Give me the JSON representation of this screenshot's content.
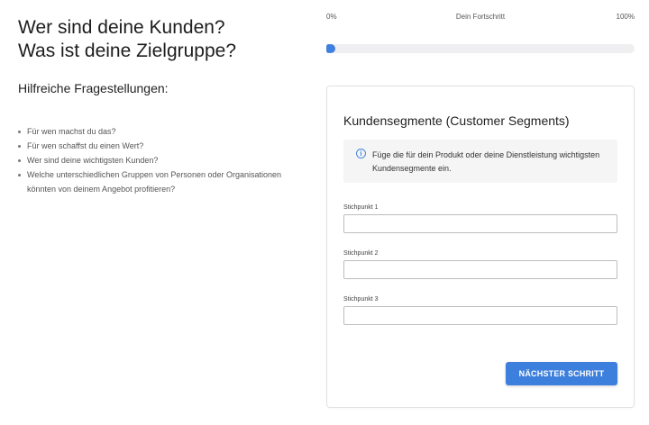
{
  "intro": {
    "title_line1": "Wer sind deine Kunden?",
    "title_line2": "Was ist deine Zielgruppe?",
    "subheading": "Hilfreiche Fragestellungen:",
    "questions": [
      "Für wen machst du das?",
      "Für wen schaffst du einen Wert?",
      "Wer sind deine wichtigsten Kunden?",
      "Welche unterschiedlichen Gruppen von Personen oder Organisationen könnten von deinem Angebot profitieren?"
    ]
  },
  "progress": {
    "min_label": "0%",
    "title": "Dein Fortschritt",
    "max_label": "100%",
    "value": 0
  },
  "card": {
    "title": "Kundensegmente (Customer Segments)",
    "info_icon": "info-icon",
    "info_text": "Füge die für dein Produkt oder deine Dienstleistung wichtigsten Kundensegmente ein.",
    "fields": [
      {
        "label": "Stichpunkt 1",
        "value": ""
      },
      {
        "label": "Stichpunkt 2",
        "value": ""
      },
      {
        "label": "Stichpunkt 3",
        "value": ""
      }
    ],
    "next_button": "NÄCHSTER SCHRITT"
  },
  "colors": {
    "accent": "#3d7fdd",
    "info_background": "#f4f5f4",
    "progress_track": "#efeff1"
  }
}
